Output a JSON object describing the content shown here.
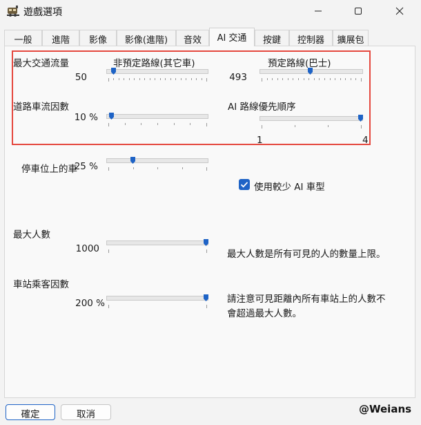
{
  "window": {
    "title": "遊戲選項",
    "minimize_icon": "minimize-icon",
    "maximize_icon": "maximize-icon",
    "close_icon": "close-icon"
  },
  "tabs": [
    {
      "label": "一般"
    },
    {
      "label": "進階"
    },
    {
      "label": "影像"
    },
    {
      "label": "影像(進階)"
    },
    {
      "label": "音效"
    },
    {
      "label": "AI 交通",
      "active": true
    },
    {
      "label": "按鍵"
    },
    {
      "label": "控制器"
    },
    {
      "label": "擴展包"
    }
  ],
  "highlight_color": "#e5483e",
  "accent_color": "#1e63c6",
  "traffic": {
    "max_flow_label": "最大交通流量",
    "unscheduled_label": "非預定路線(其它車)",
    "unscheduled_value": "50",
    "unscheduled_level": 0.05,
    "scheduled_label": "預定路線(巴士)",
    "scheduled_value": "493",
    "scheduled_level": 0.49,
    "density_label": "道路車流因數",
    "density_value": "10 %",
    "density_level": 0.03,
    "priority_label": "AI 路線優先順序",
    "priority_min": "1",
    "priority_max": "4",
    "priority_level": 1.0
  },
  "parking": {
    "label": "停車位上的車",
    "value": "25 %",
    "level": 0.25
  },
  "fewer_models": {
    "label": "使用較少 AI 車型",
    "checked": true
  },
  "people": {
    "max_label": "最大人數",
    "max_value": "1000",
    "max_level": 1.0,
    "max_desc": "最大人數是所有可見的人的數量上限。",
    "station_label": "車站乘客因數",
    "station_value": "200 %",
    "station_level": 1.0,
    "station_desc_line1": "請注意可見距離內所有車站上的人數不",
    "station_desc_line2": "會超過最大人數。"
  },
  "buttons": {
    "ok": "確定",
    "cancel": "取消"
  },
  "watermark": "@Weians"
}
